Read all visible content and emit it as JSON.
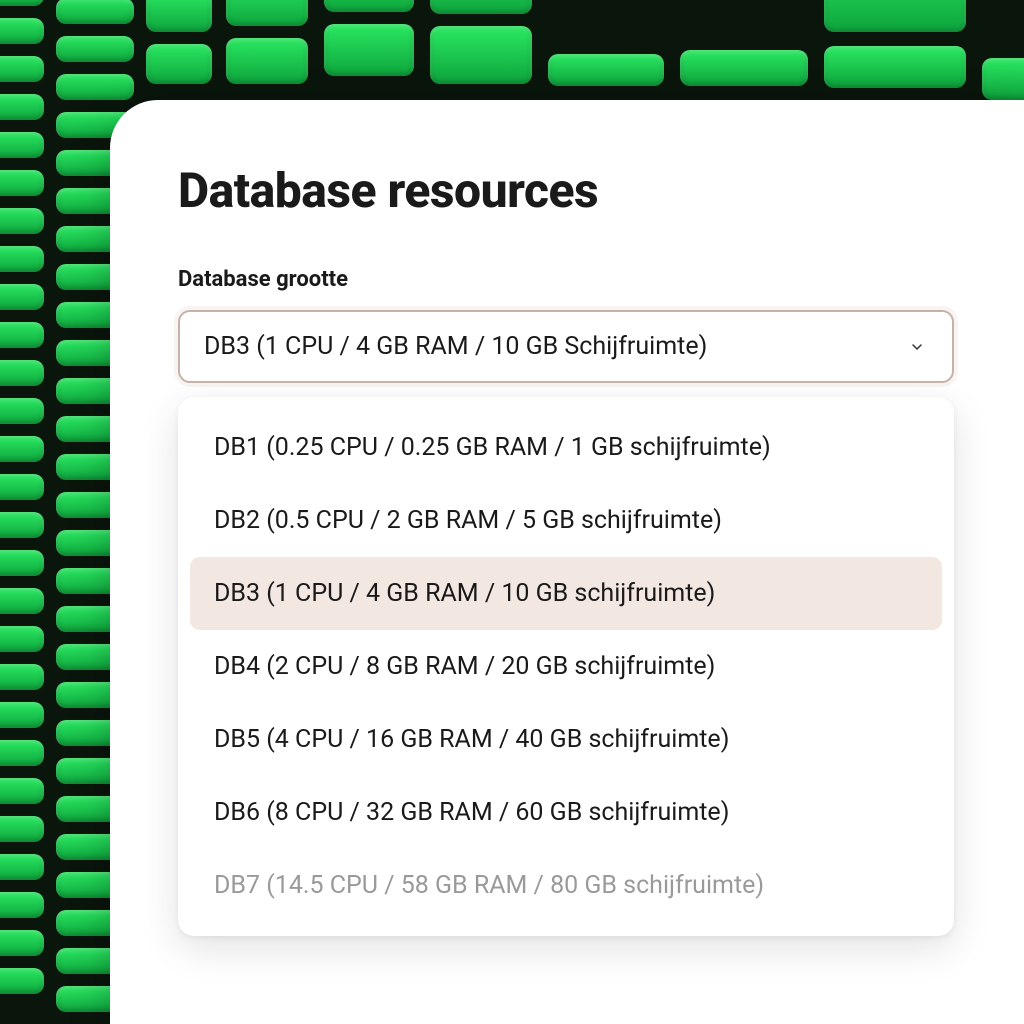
{
  "header": {
    "title": "Database resources"
  },
  "field": {
    "label": "Database grootte",
    "selected_value": "DB3 (1 CPU / 4 GB RAM / 10 GB Schijfruimte)"
  },
  "options": [
    {
      "label": "DB1 (0.25 CPU / 0.25 GB RAM / 1 GB schijfruimte)",
      "selected": false,
      "disabled": false
    },
    {
      "label": "DB2 (0.5 CPU / 2 GB RAM / 5 GB schijfruimte)",
      "selected": false,
      "disabled": false
    },
    {
      "label": "DB3 (1 CPU / 4 GB RAM / 10 GB schijfruimte)",
      "selected": true,
      "disabled": false
    },
    {
      "label": "DB4 (2 CPU / 8 GB RAM / 20 GB schijfruimte)",
      "selected": false,
      "disabled": false
    },
    {
      "label": "DB5 (4 CPU / 16 GB RAM / 40 GB schijfruimte)",
      "selected": false,
      "disabled": false
    },
    {
      "label": "DB6 (8 CPU / 32 GB RAM / 60 GB schijfruimte)",
      "selected": false,
      "disabled": false
    },
    {
      "label": "DB7 (14.5 CPU / 58 GB RAM / 80 GB schijfruimte)",
      "selected": false,
      "disabled": true
    }
  ]
}
